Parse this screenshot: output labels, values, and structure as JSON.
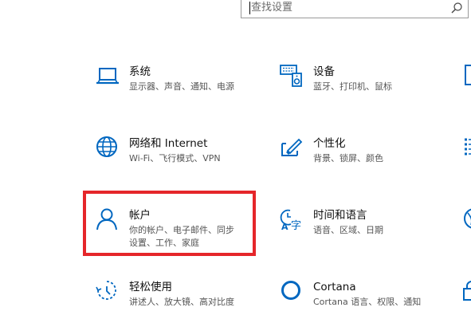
{
  "search": {
    "placeholder": "查找设置"
  },
  "accent_color": "#0067c0",
  "highlight_color": "#e5262a",
  "tiles": [
    {
      "title": "系统",
      "desc": "显示器、声音、通知、电源",
      "icon": "laptop-icon"
    },
    {
      "title": "设备",
      "desc": "蓝牙、打印机、鼠标",
      "icon": "keyboard-speaker-icon"
    },
    {
      "title": "网络和 Internet",
      "desc": "Wi-Fi、飞行模式、VPN",
      "icon": "globe-icon"
    },
    {
      "title": "个性化",
      "desc": "背景、锁屏、颜色",
      "icon": "paint-brush-icon"
    },
    {
      "title": "帐户",
      "desc": "你的帐户、电子邮件、同步设置、工作、家庭",
      "icon": "person-icon"
    },
    {
      "title": "时间和语言",
      "desc": "语音、区域、日期",
      "icon": "time-language-icon"
    },
    {
      "title": "轻松使用",
      "desc": "讲述人、放大镜、高对比度",
      "icon": "ease-of-access-icon"
    },
    {
      "title": "Cortana",
      "desc": "Cortana 语言、权限、通知",
      "icon": "cortana-icon"
    }
  ]
}
